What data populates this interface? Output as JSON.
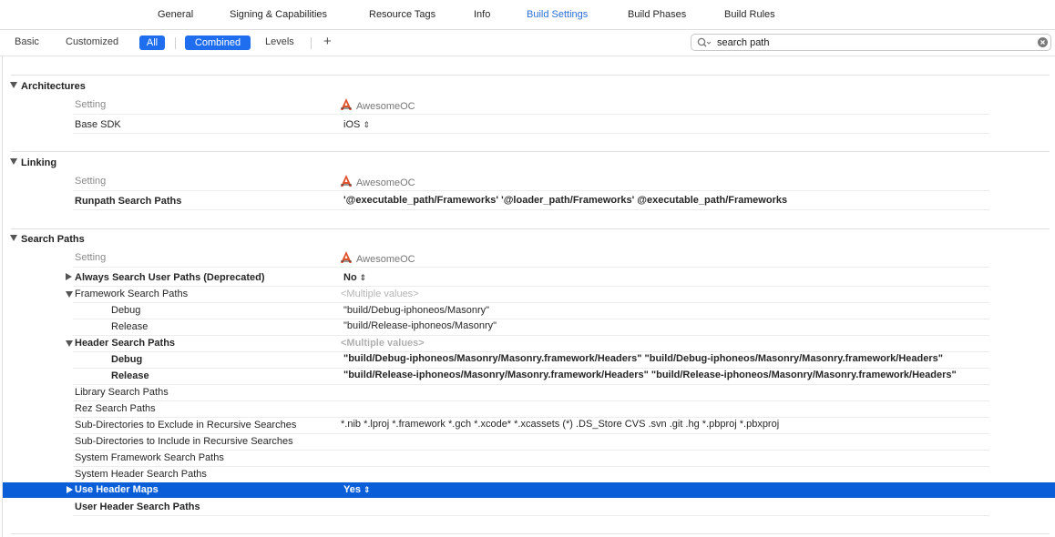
{
  "tabs": [
    {
      "label": "General",
      "active": false
    },
    {
      "label": "Signing & Capabilities",
      "active": false
    },
    {
      "label": "Resource Tags",
      "active": false
    },
    {
      "label": "Info",
      "active": false
    },
    {
      "label": "Build Settings",
      "active": true
    },
    {
      "label": "Build Phases",
      "active": false
    },
    {
      "label": "Build Rules",
      "active": false
    }
  ],
  "filter": {
    "basic": "Basic",
    "customized": "Customized",
    "all": "All",
    "combined": "Combined",
    "levels": "Levels",
    "add": "+"
  },
  "search": {
    "value": "search path"
  },
  "target_name": "AwesomeOC",
  "setting_header": "Setting",
  "updown_glyph": "⇕",
  "sections": {
    "architectures": {
      "title": "Architectures",
      "rows": [
        {
          "name": "Base SDK",
          "value": "iOS"
        }
      ]
    },
    "linking": {
      "title": "Linking",
      "rows": [
        {
          "name": "Runpath Search Paths",
          "value": "'@executable_path/Frameworks' '@loader_path/Frameworks' @executable_path/Frameworks"
        }
      ]
    },
    "search_paths": {
      "title": "Search Paths",
      "rows": [
        {
          "name": "Always Search User Paths (Deprecated)",
          "value": "No"
        },
        {
          "name": "Framework Search Paths",
          "value": "<Multiple values>"
        },
        {
          "name": "Debug",
          "value": "\"build/Debug-iphoneos/Masonry\""
        },
        {
          "name": "Release",
          "value": "\"build/Release-iphoneos/Masonry\""
        },
        {
          "name": "Header Search Paths",
          "value": "<Multiple values>"
        },
        {
          "name": "Debug",
          "value": "\"build/Debug-iphoneos/Masonry/Masonry.framework/Headers\" \"build/Debug-iphoneos/Masonry/Masonry.framework/Headers\""
        },
        {
          "name": "Release",
          "value": "\"build/Release-iphoneos/Masonry/Masonry.framework/Headers\" \"build/Release-iphoneos/Masonry/Masonry.framework/Headers\""
        },
        {
          "name": "Library Search Paths",
          "value": ""
        },
        {
          "name": "Rez Search Paths",
          "value": ""
        },
        {
          "name": "Sub-Directories to Exclude in Recursive Searches",
          "value": "*.nib *.lproj *.framework *.gch *.xcode* *.xcassets (*) .DS_Store CVS .svn .git .hg *.pbproj *.pbxproj"
        },
        {
          "name": "Sub-Directories to Include in Recursive Searches",
          "value": ""
        },
        {
          "name": "System Framework Search Paths",
          "value": ""
        },
        {
          "name": "System Header Search Paths",
          "value": ""
        },
        {
          "name": "Use Header Maps",
          "value": "Yes",
          "selected": true
        },
        {
          "name": "User Header Search Paths",
          "value": ""
        }
      ]
    }
  },
  "colors": {
    "accent": "#2a6fd6",
    "pill": "#1f6ef0",
    "selection": "#0a5fd8"
  }
}
